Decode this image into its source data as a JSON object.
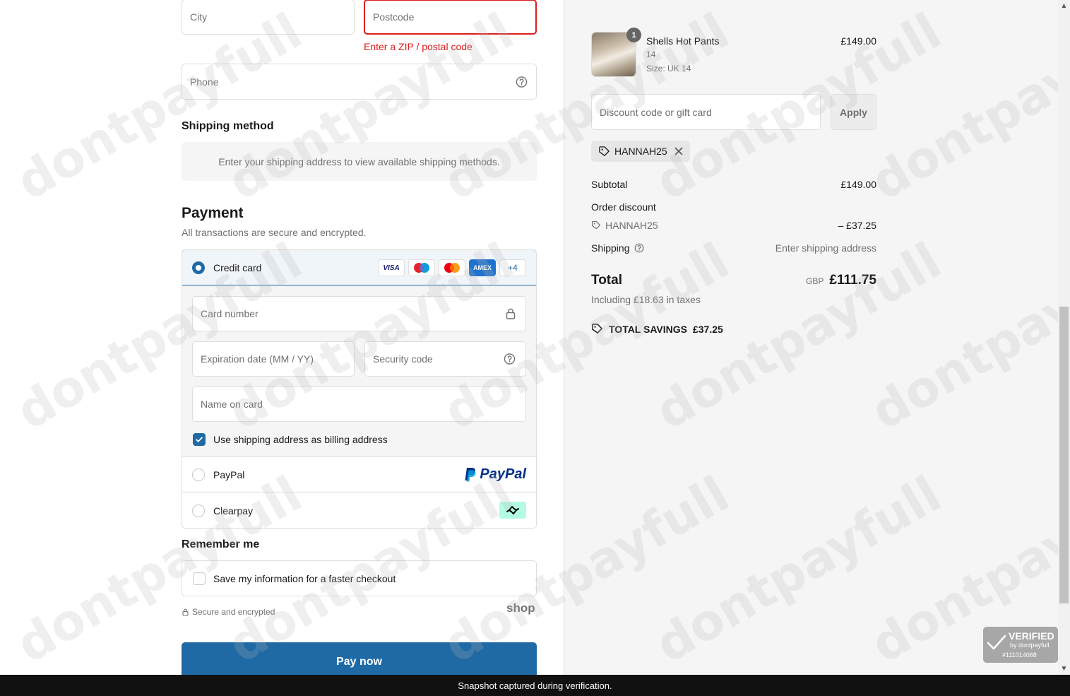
{
  "contact_form": {
    "city_placeholder": "City",
    "postcode_placeholder": "Postcode",
    "postcode_error": "Enter a ZIP / postal code",
    "phone_placeholder": "Phone"
  },
  "shipping": {
    "heading": "Shipping method",
    "empty_message": "Enter your shipping address to view available shipping methods."
  },
  "payment": {
    "heading": "Payment",
    "subtitle": "All transactions are secure and encrypted.",
    "credit_card_label": "Credit card",
    "brands": [
      "VISA",
      "Maestro",
      "Mastercard",
      "AMEX"
    ],
    "more_brands": "+4",
    "card_number_placeholder": "Card number",
    "expiration_placeholder": "Expiration date (MM / YY)",
    "security_code_placeholder": "Security code",
    "name_on_card_placeholder": "Name on card",
    "billing_checkbox_label": "Use shipping address as billing address",
    "paypal_label": "PayPal",
    "paypal_logo": "PayPal",
    "clearpay_label": "Clearpay"
  },
  "remember": {
    "heading": "Remember me",
    "save_label": "Save my information for a faster checkout"
  },
  "secure_note": "Secure and encrypted",
  "shop_logo": "shop",
  "pay_button": "Pay now",
  "summary": {
    "product": {
      "name": "Shells Hot Pants",
      "variant": "14",
      "size": "Size: UK 14",
      "price": "£149.00",
      "quantity": "1"
    },
    "discount_placeholder": "Discount code or gift card",
    "apply_label": "Apply",
    "applied_code": "HANNAH25",
    "subtotal_label": "Subtotal",
    "subtotal_value": "£149.00",
    "order_discount_label": "Order discount",
    "discount_code": "HANNAH25",
    "discount_value": "– £37.25",
    "shipping_label": "Shipping",
    "shipping_value": "Enter shipping address",
    "total_label": "Total",
    "currency": "GBP",
    "total_value": "£111.75",
    "tax_note": "Including £18.63 in taxes",
    "savings_label": "TOTAL SAVINGS",
    "savings_value": "£37.25"
  },
  "verified_badge": {
    "title": "VERIFIED",
    "by": "by dontpayfull",
    "id": "#111014068"
  },
  "watermark_text": "dontpayfull",
  "footer": "Snapshot captured during verification.",
  "colors": {
    "accent": "#1f6aa5",
    "error": "#dd1d1d",
    "summary_bg": "#f5f5f5"
  }
}
